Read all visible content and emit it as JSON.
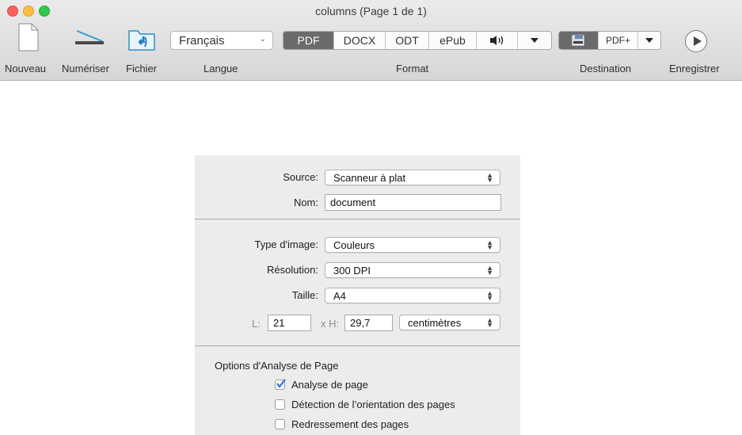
{
  "window": {
    "title": "columns (Page 1 de 1)"
  },
  "toolbar": {
    "nouveau_label": "Nouveau",
    "numeriser_label": "Numériser",
    "fichier_label": "Fichier",
    "langue_label": "Langue",
    "langue_value": "Français",
    "format_label": "Format",
    "format_options": [
      "PDF",
      "DOCX",
      "ODT",
      "ePub"
    ],
    "format_selected": "PDF",
    "destination_label": "Destination",
    "destination_pdfplus": "PDF+",
    "enregistrer_label": "Enregistrer"
  },
  "panel": {
    "source_label": "Source:",
    "source_value": "Scanneur à plat",
    "nom_label": "Nom:",
    "nom_value": "document",
    "type_label": "Type d'image:",
    "type_value": "Couleurs",
    "resolution_label": "Résolution:",
    "resolution_value": "300 DPI",
    "taille_label": "Taille:",
    "taille_value": "A4",
    "width_label": "L:",
    "width_value": "21",
    "height_label": "x H:",
    "height_value": "29,7",
    "unit_value": "centimètres",
    "options_title": "Options d'Analyse de Page",
    "options": [
      {
        "label": "Analyse de page",
        "checked": true
      },
      {
        "label": "Détection de l’orientation des pages",
        "checked": false
      },
      {
        "label": "Redressement des pages",
        "checked": false
      }
    ]
  },
  "colors": {
    "accent": "#2f6fd6",
    "segment_on": "#6b6b6b"
  }
}
